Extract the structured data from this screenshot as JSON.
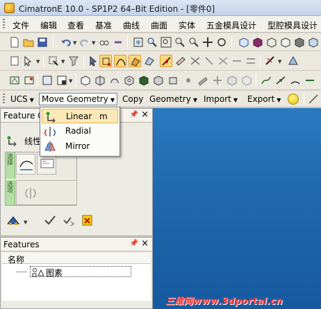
{
  "window": {
    "title": "CimatronE 10.0 - SP1P2 64–Bit Edition - [零件0]"
  },
  "menu": [
    "文件",
    "编辑",
    "查看",
    "基准",
    "曲线",
    "曲面",
    "实体",
    "五金模具设计",
    "型腔模具设计"
  ],
  "commandbar": {
    "ucs": "UCS",
    "move_geometry": "Move Geometry",
    "copy": "Copy",
    "geometry": "Geometry",
    "import": "Import",
    "export": "Export"
  },
  "dropdown": {
    "items": [
      {
        "label": "Linear",
        "key": "m"
      },
      {
        "label": "Radial",
        "key": ""
      },
      {
        "label": "Mirror",
        "key": ""
      }
    ]
  },
  "feature_guide": {
    "title": "Feature G",
    "current_label": "线性",
    "tab_top": "选择",
    "tab_bottom": "选项"
  },
  "features_panel": {
    "title": "Features",
    "column": "名称",
    "item": "图素"
  },
  "watermark": "三维网www.3dportal.cn",
  "colors": {
    "viewport_top": "#2a79bf",
    "viewport_bottom": "#165aa0",
    "highlight": "#fde9b8",
    "pressed": "#ffd77a",
    "watermark": "#ff2a2a"
  }
}
